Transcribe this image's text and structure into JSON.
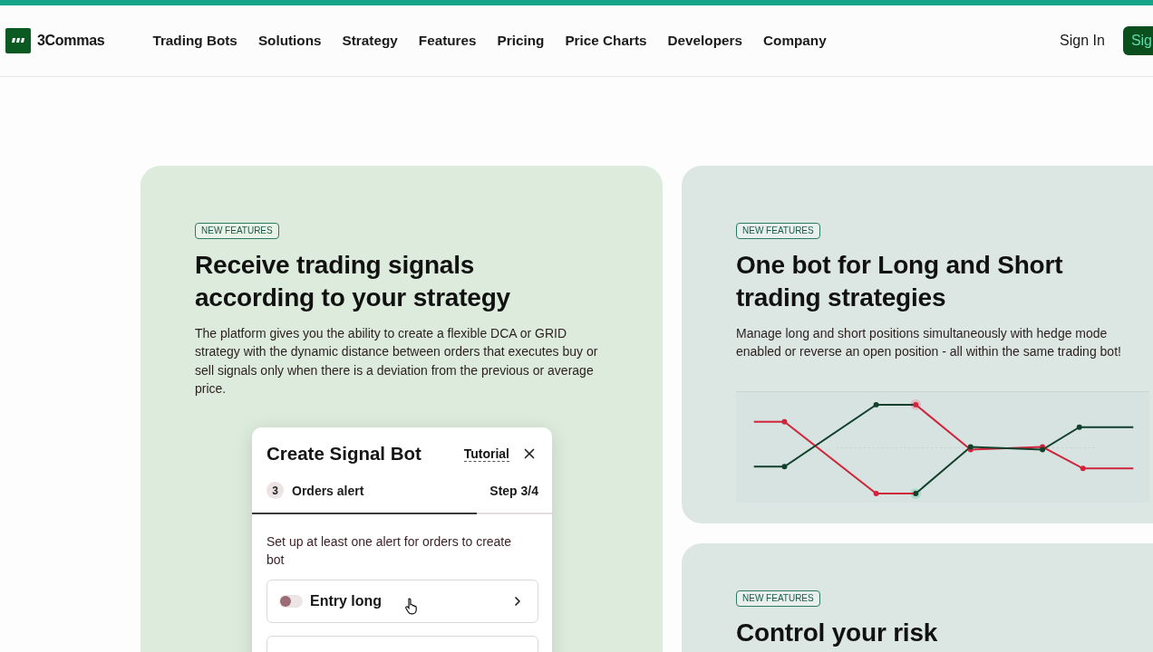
{
  "header": {
    "logo": {
      "text": "3Commas"
    },
    "nav": [
      "Trading Bots",
      "Solutions",
      "Strategy",
      "Features",
      "Pricing",
      "Price Charts",
      "Developers",
      "Company"
    ],
    "sign_in": "Sign In",
    "sign_up_button": "Sig"
  },
  "feature_cards": [
    {
      "kind": "dialog",
      "badge": "NEW FEATURES",
      "title": "Receive trading signals according to your strategy",
      "description": "The platform gives you the ability to create a flexible DCA or GRID strategy with the dynamic distance between orders that executes buy or sell signals only when there is a deviation from the previous or average price.",
      "dialog": {
        "title": "Create Signal Bot",
        "tutorial_link": "Tutorial",
        "step": {
          "number": "3",
          "name": "Orders alert",
          "counter": "Step 3/4"
        },
        "progress": {
          "level": 0.75
        },
        "instruction": "Set up at least one alert for orders to create bot",
        "alerts": [
          {
            "kind": "toggle_row",
            "label": "Entry long",
            "on": false
          },
          {
            "kind": "empty_row"
          }
        ]
      }
    },
    {
      "kind": "chart",
      "badge": "NEW FEATURES",
      "title": "One bot for Long and Short trading strategies",
      "description": "Manage long and short positions simultaneously with hedge mode enabled or reverse an open position - all within the same trading bot!"
    },
    {
      "kind": "plain",
      "badge": "NEW FEATURES",
      "title": "Control your risk"
    }
  ]
}
